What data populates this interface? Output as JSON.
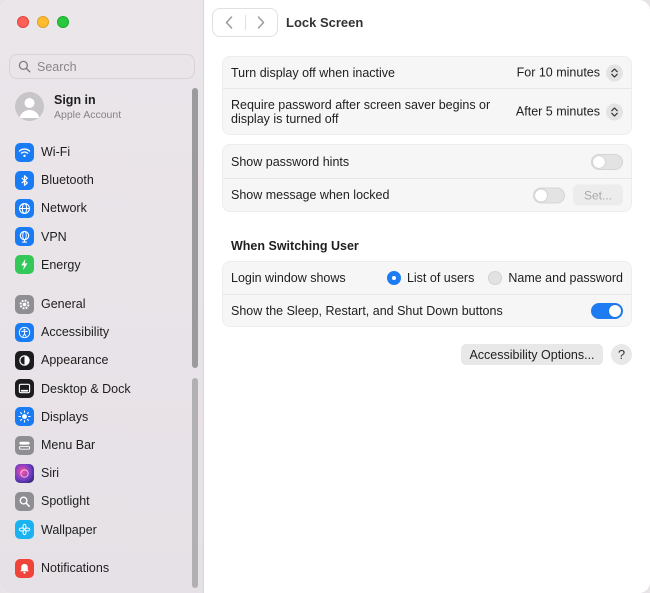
{
  "search": {
    "placeholder": "Search"
  },
  "account": {
    "name": "Sign in",
    "subtitle": "Apple Account"
  },
  "sidebar": {
    "group1": [
      {
        "label": "Wi-Fi",
        "icon": "wifi-icon",
        "color": "#1a7cf5"
      },
      {
        "label": "Bluetooth",
        "icon": "bluetooth-icon",
        "color": "#1a7cf5"
      },
      {
        "label": "Network",
        "icon": "globe-icon",
        "color": "#1a7cf5"
      },
      {
        "label": "VPN",
        "icon": "vpn-globe-icon",
        "color": "#1a7cf5"
      },
      {
        "label": "Energy",
        "icon": "bolt-icon",
        "color": "#34c759"
      }
    ],
    "group2": [
      {
        "label": "General",
        "icon": "gear-icon",
        "color": "#8e8e93"
      },
      {
        "label": "Accessibility",
        "icon": "accessibility-icon",
        "color": "#1a7cf5"
      },
      {
        "label": "Appearance",
        "icon": "appearance-icon",
        "color": "#1c1c1e"
      },
      {
        "label": "Desktop & Dock",
        "icon": "dock-icon",
        "color": "#1c1c1e"
      },
      {
        "label": "Displays",
        "icon": "sun-icon",
        "color": "#1a7cf5"
      },
      {
        "label": "Menu Bar",
        "icon": "menubar-icon",
        "color": "#8e8e93"
      },
      {
        "label": "Siri",
        "icon": "siri-icon",
        "color": "#6a3cc7"
      },
      {
        "label": "Spotlight",
        "icon": "magnifier-icon",
        "color": "#8e8e93"
      },
      {
        "label": "Wallpaper",
        "icon": "flower-icon",
        "color": "#1ab2f0"
      }
    ],
    "group3": [
      {
        "label": "Notifications",
        "icon": "bell-icon",
        "color": "#f0443a"
      }
    ]
  },
  "page": {
    "title": "Lock Screen"
  },
  "display": {
    "row1": {
      "label": "Turn display off when inactive",
      "value": "For 10 minutes"
    },
    "row2": {
      "label_line1": "Require password after screen saver begins or",
      "label_line2": "display is turned off",
      "value": "After 5 minutes"
    }
  },
  "hints": {
    "row1": {
      "label": "Show password hints",
      "on": false
    },
    "row2": {
      "label": "Show message when locked",
      "on": false,
      "button": "Set..."
    }
  },
  "switching": {
    "title": "When Switching User",
    "row1": {
      "label": "Login window shows",
      "option1": "List of users",
      "option2": "Name and password",
      "selected": "List of users"
    },
    "row2": {
      "label": "Show the Sleep, Restart, and Shut Down buttons",
      "on": true
    }
  },
  "footer": {
    "accessibility_button": "Accessibility Options...",
    "help": "?"
  },
  "colors": {
    "accent": "#1e7cf2"
  }
}
